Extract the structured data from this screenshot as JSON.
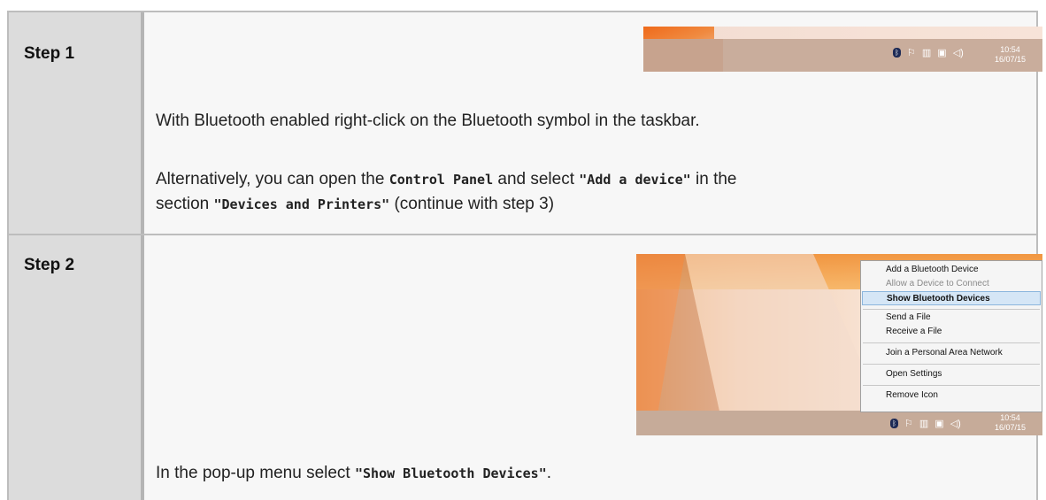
{
  "steps": [
    {
      "label": "Step 1",
      "paragraph1": "With Bluetooth enabled right-click on the Bluetooth symbol in the taskbar.",
      "paragraph2": {
        "t1": "Alternatively, you can open the ",
        "c1": "Control Panel",
        "t2": " and select ",
        "c2": "\"Add a device\"",
        "t3": " in the",
        "t4": "section ",
        "c3": "\"Devices and Printers\"",
        "t5": " (continue with step 3)"
      },
      "screenshot": {
        "time": "10:54",
        "date": "16/07/15"
      }
    },
    {
      "label": "Step 2",
      "paragraph": {
        "t1": "In the pop-up menu select ",
        "c1": "\"Show Bluetooth Devices\"",
        "t2": "."
      },
      "screenshot": {
        "menu_items": [
          "Add a Bluetooth Device",
          "Allow a Device to Connect",
          "Show Bluetooth Devices",
          "Send a File",
          "Receive a File",
          "Join a Personal Area Network",
          "Open Settings",
          "Remove Icon"
        ],
        "time": "10:54",
        "date": "16/07/15"
      }
    }
  ]
}
